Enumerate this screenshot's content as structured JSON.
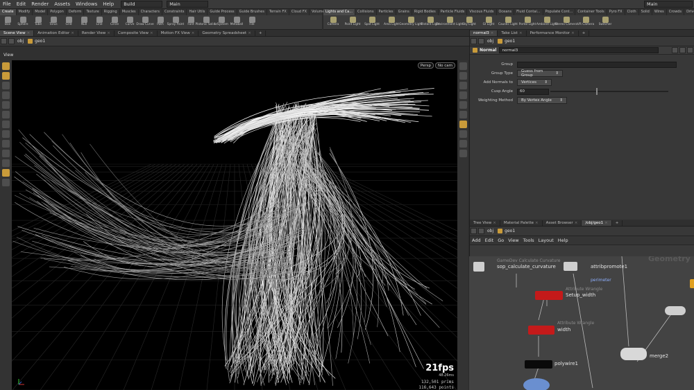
{
  "menubar": {
    "items": [
      "File",
      "Edit",
      "Render",
      "Assets",
      "Windows",
      "Help"
    ],
    "desktop_label": "Build",
    "desktop2_label": "Main",
    "right_label": "Main"
  },
  "shelf_left": {
    "tabs": [
      "Create",
      "Modify",
      "Model",
      "Polygon",
      "Deform",
      "Texture",
      "Rigging",
      "Muscles",
      "Characters",
      "Constraints",
      "Hair Utils",
      "Guide Process",
      "Guide Brushes",
      "Terrain FX",
      "Cloud FX",
      "Volume"
    ],
    "tools": [
      "Box",
      "Sphere",
      "Tube",
      "Torus",
      "Grid",
      "Null",
      "Line",
      "Circle",
      "Curve",
      "Draw Curve",
      "Path",
      "Spray Paint",
      "Font",
      "Platonic Solids",
      "L-System",
      "Metaball",
      "File"
    ]
  },
  "shelf_right": {
    "tabs": [
      "Lights and Ca...",
      "Collisions",
      "Particles",
      "Grains",
      "Rigid Bodies",
      "Particle Fluids",
      "Viscous Fluids",
      "Oceans",
      "Fluid Contai...",
      "Populate Cont...",
      "Container Tools",
      "Pyro FX",
      "Cloth",
      "Solid",
      "Wires",
      "Crowds",
      "Drive Simula..."
    ],
    "tools": [
      "Camera",
      "Point Light",
      "Spot Light",
      "Area Light",
      "Geometry Light",
      "Distant Light",
      "Environment Light",
      "Sky Light",
      "GI Light",
      "Caustic Light",
      "Portal Light",
      "Ambient Light",
      "Stereo Camera",
      "VR Camera",
      "Switcher"
    ]
  },
  "viewer": {
    "tabs": [
      "Scene View",
      "Animation Editor",
      "Render View",
      "Composite View",
      "Motion FX View",
      "Geometry Spreadsheet"
    ],
    "path": [
      "obj",
      "geo1"
    ],
    "title": "View",
    "persp": "Persp",
    "cam": "No cam",
    "fps": "21fps",
    "ms": "48.26ms",
    "prims_value": "132,501",
    "prims_label": "prims",
    "points_value": "116,643",
    "points_label": "points"
  },
  "parms": {
    "tabs": [
      "normal3",
      "Take List",
      "Performance Monitor"
    ],
    "path": [
      "obj",
      "geo1"
    ],
    "node_type": "Normal",
    "node_name": "normal3",
    "fields": [
      {
        "label": "Group",
        "value": ""
      },
      {
        "label": "Group Type",
        "value": "Guess from Group"
      },
      {
        "label": "Add Normals to",
        "value": "Vertices"
      },
      {
        "label": "Cusp Angle",
        "value": "60"
      },
      {
        "label": "Weighting Method",
        "value": "By Vertex Angle"
      }
    ]
  },
  "network": {
    "tabs": [
      "Tree View",
      "Material Palette",
      "Asset Browser",
      "/obj/geo1"
    ],
    "path": [
      "obj",
      "geo1"
    ],
    "menu": [
      "Add",
      "Edit",
      "Go",
      "View",
      "Tools",
      "Layout",
      "Help"
    ],
    "context": "Geometry",
    "nodes": {
      "calc_curv_sub": "GameDev Calculate Curvature",
      "calc_curv": "sop_calculate_curvature",
      "promote": "attribpromote1",
      "perimeter": "perimeter",
      "wrangle1_sub": "Attribute Wrangle",
      "wrangle1": "Setup_width",
      "wrangle2_sub": "Attribute Wrangle",
      "wrangle2": "width",
      "polywire": "polywire1",
      "merge": "merge2"
    }
  },
  "colors": {
    "accent": "#c99b3a",
    "wrangle": "#c41a1a",
    "viewport_bg": "#000000"
  }
}
